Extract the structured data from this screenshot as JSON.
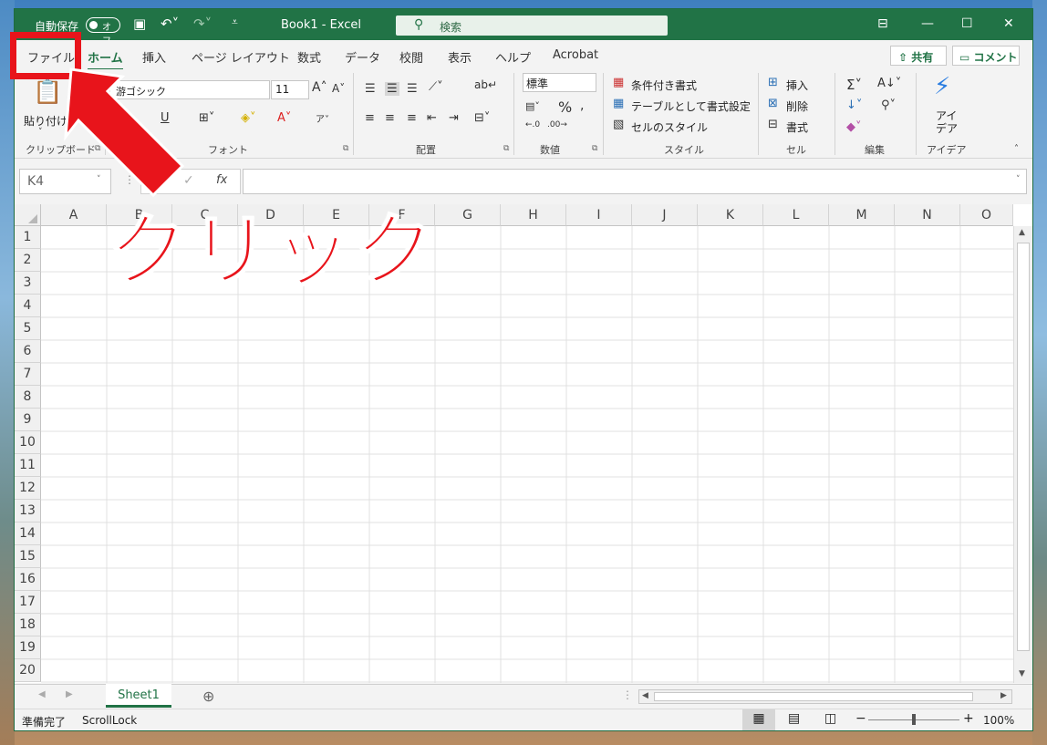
{
  "window": {
    "autosave_label": "自動保存",
    "autosave_state": "オフ",
    "title": "Book1  -  Excel",
    "search_placeholder": "検索"
  },
  "tabs": [
    {
      "label": "ファイル"
    },
    {
      "label": "ホーム"
    },
    {
      "label": "挿入"
    },
    {
      "label": "ページ レイアウト"
    },
    {
      "label": "数式"
    },
    {
      "label": "データ"
    },
    {
      "label": "校閲"
    },
    {
      "label": "表示"
    },
    {
      "label": "ヘルプ"
    },
    {
      "label": "Acrobat"
    }
  ],
  "share_label": "共有",
  "comment_label": "コメント",
  "ribbon": {
    "clipboard": {
      "paste": "貼り付け",
      "label": "クリップボード"
    },
    "font": {
      "name": "游ゴシック",
      "size": "11",
      "label": "フォント"
    },
    "alignment": {
      "label": "配置"
    },
    "number": {
      "format": "標準",
      "label": "数値"
    },
    "styles": {
      "conditional": "条件付き書式",
      "table": "テーブルとして書式設定",
      "cell": "セルのスタイル",
      "label": "スタイル"
    },
    "cells": {
      "insert": "挿入",
      "delete": "削除",
      "format": "書式",
      "label": "セル"
    },
    "editing": {
      "label": "編集"
    },
    "ideas": {
      "line1": "アイ",
      "line2": "デア",
      "label": "アイデア"
    }
  },
  "namebox": "K4",
  "fx": "fx",
  "columns": [
    "A",
    "B",
    "C",
    "D",
    "E",
    "F",
    "G",
    "H",
    "I",
    "J",
    "K",
    "L",
    "M",
    "N",
    "O"
  ],
  "rows": [
    "1",
    "2",
    "3",
    "4",
    "5",
    "6",
    "7",
    "8",
    "9",
    "10",
    "11",
    "12",
    "13",
    "14",
    "15",
    "16",
    "17",
    "18",
    "19",
    "20"
  ],
  "sheet": "Sheet1",
  "status": {
    "ready": "準備完了",
    "scroll": "ScrollLock",
    "zoom": "100%"
  },
  "annotation": {
    "text": "クリック",
    "color": "#e8141b"
  }
}
